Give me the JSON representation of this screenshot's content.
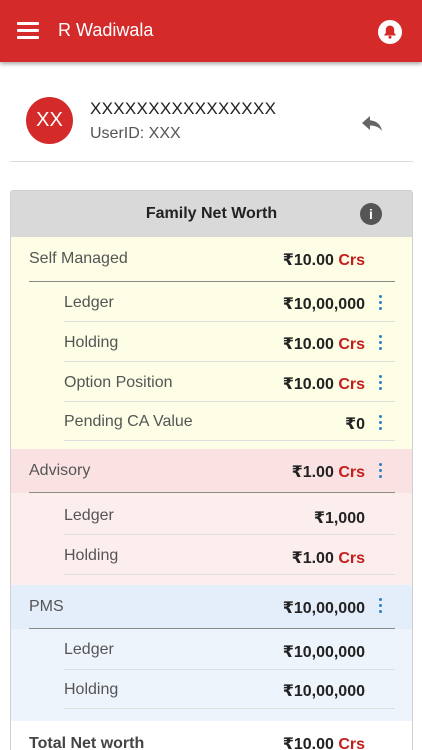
{
  "appbar": {
    "title": "R Wadiwala",
    "menu_icon": "hamburger-menu-icon",
    "notification_icon": "bell-icon"
  },
  "profile": {
    "avatar_initials": "XX",
    "name": "XXXXXXXXXXXXXXXX",
    "user_id": "UserID: XXX",
    "action_icon": "reply-arrow-icon"
  },
  "card": {
    "title": "Family Net Worth",
    "info_icon_glyph": "i",
    "self_managed": {
      "label": "Self Managed",
      "amount": "₹10.00",
      "unit": "Crs",
      "items": [
        {
          "label": "Ledger",
          "amount": "₹10,00,000",
          "unit": ""
        },
        {
          "label": "Holding",
          "amount": "₹10.00",
          "unit": "Crs"
        },
        {
          "label": "Option Position",
          "amount": "₹10.00",
          "unit": "Crs"
        },
        {
          "label": "Pending CA Value",
          "amount": "₹0",
          "unit": ""
        }
      ]
    },
    "advisory": {
      "label": "Advisory",
      "amount": "₹1.00",
      "unit": "Crs",
      "items": [
        {
          "label": "Ledger",
          "amount": "₹1,000",
          "unit": ""
        },
        {
          "label": "Holding",
          "amount": "₹1.00",
          "unit": "Crs"
        }
      ]
    },
    "pms": {
      "label": "PMS",
      "amount": "₹10,00,000",
      "unit": "",
      "items": [
        {
          "label": "Ledger",
          "amount": "₹10,00,000",
          "unit": ""
        },
        {
          "label": "Holding",
          "amount": "₹10,00,000",
          "unit": ""
        }
      ]
    },
    "total": {
      "label": "Total Net worth",
      "amount": "₹10.00",
      "unit": "Crs"
    }
  },
  "colors": {
    "brand_red": "#d42a2a",
    "unit_red": "#c31d1d",
    "kebab_blue": "#2a7fc6"
  }
}
